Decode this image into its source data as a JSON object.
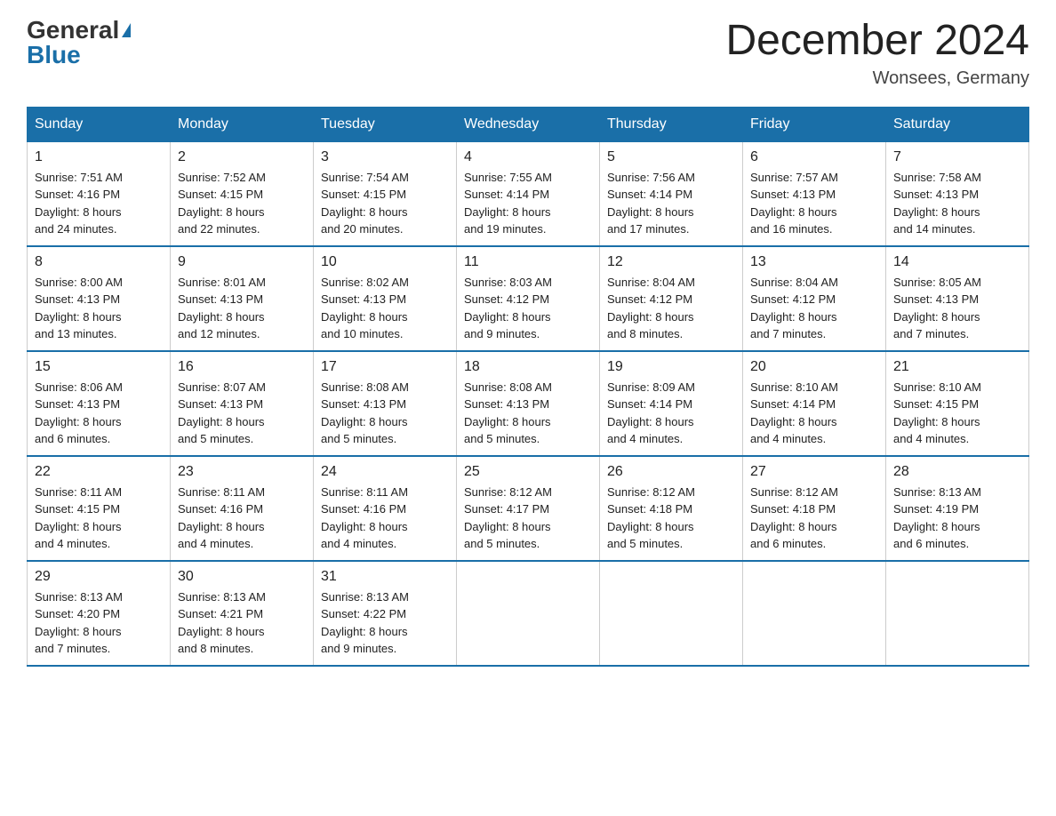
{
  "logo": {
    "general": "General",
    "blue": "Blue"
  },
  "header": {
    "month_year": "December 2024",
    "location": "Wonsees, Germany"
  },
  "days_of_week": [
    "Sunday",
    "Monday",
    "Tuesday",
    "Wednesday",
    "Thursday",
    "Friday",
    "Saturday"
  ],
  "weeks": [
    [
      {
        "day": "1",
        "info": "Sunrise: 7:51 AM\nSunset: 4:16 PM\nDaylight: 8 hours\nand 24 minutes."
      },
      {
        "day": "2",
        "info": "Sunrise: 7:52 AM\nSunset: 4:15 PM\nDaylight: 8 hours\nand 22 minutes."
      },
      {
        "day": "3",
        "info": "Sunrise: 7:54 AM\nSunset: 4:15 PM\nDaylight: 8 hours\nand 20 minutes."
      },
      {
        "day": "4",
        "info": "Sunrise: 7:55 AM\nSunset: 4:14 PM\nDaylight: 8 hours\nand 19 minutes."
      },
      {
        "day": "5",
        "info": "Sunrise: 7:56 AM\nSunset: 4:14 PM\nDaylight: 8 hours\nand 17 minutes."
      },
      {
        "day": "6",
        "info": "Sunrise: 7:57 AM\nSunset: 4:13 PM\nDaylight: 8 hours\nand 16 minutes."
      },
      {
        "day": "7",
        "info": "Sunrise: 7:58 AM\nSunset: 4:13 PM\nDaylight: 8 hours\nand 14 minutes."
      }
    ],
    [
      {
        "day": "8",
        "info": "Sunrise: 8:00 AM\nSunset: 4:13 PM\nDaylight: 8 hours\nand 13 minutes."
      },
      {
        "day": "9",
        "info": "Sunrise: 8:01 AM\nSunset: 4:13 PM\nDaylight: 8 hours\nand 12 minutes."
      },
      {
        "day": "10",
        "info": "Sunrise: 8:02 AM\nSunset: 4:13 PM\nDaylight: 8 hours\nand 10 minutes."
      },
      {
        "day": "11",
        "info": "Sunrise: 8:03 AM\nSunset: 4:12 PM\nDaylight: 8 hours\nand 9 minutes."
      },
      {
        "day": "12",
        "info": "Sunrise: 8:04 AM\nSunset: 4:12 PM\nDaylight: 8 hours\nand 8 minutes."
      },
      {
        "day": "13",
        "info": "Sunrise: 8:04 AM\nSunset: 4:12 PM\nDaylight: 8 hours\nand 7 minutes."
      },
      {
        "day": "14",
        "info": "Sunrise: 8:05 AM\nSunset: 4:13 PM\nDaylight: 8 hours\nand 7 minutes."
      }
    ],
    [
      {
        "day": "15",
        "info": "Sunrise: 8:06 AM\nSunset: 4:13 PM\nDaylight: 8 hours\nand 6 minutes."
      },
      {
        "day": "16",
        "info": "Sunrise: 8:07 AM\nSunset: 4:13 PM\nDaylight: 8 hours\nand 5 minutes."
      },
      {
        "day": "17",
        "info": "Sunrise: 8:08 AM\nSunset: 4:13 PM\nDaylight: 8 hours\nand 5 minutes."
      },
      {
        "day": "18",
        "info": "Sunrise: 8:08 AM\nSunset: 4:13 PM\nDaylight: 8 hours\nand 5 minutes."
      },
      {
        "day": "19",
        "info": "Sunrise: 8:09 AM\nSunset: 4:14 PM\nDaylight: 8 hours\nand 4 minutes."
      },
      {
        "day": "20",
        "info": "Sunrise: 8:10 AM\nSunset: 4:14 PM\nDaylight: 8 hours\nand 4 minutes."
      },
      {
        "day": "21",
        "info": "Sunrise: 8:10 AM\nSunset: 4:15 PM\nDaylight: 8 hours\nand 4 minutes."
      }
    ],
    [
      {
        "day": "22",
        "info": "Sunrise: 8:11 AM\nSunset: 4:15 PM\nDaylight: 8 hours\nand 4 minutes."
      },
      {
        "day": "23",
        "info": "Sunrise: 8:11 AM\nSunset: 4:16 PM\nDaylight: 8 hours\nand 4 minutes."
      },
      {
        "day": "24",
        "info": "Sunrise: 8:11 AM\nSunset: 4:16 PM\nDaylight: 8 hours\nand 4 minutes."
      },
      {
        "day": "25",
        "info": "Sunrise: 8:12 AM\nSunset: 4:17 PM\nDaylight: 8 hours\nand 5 minutes."
      },
      {
        "day": "26",
        "info": "Sunrise: 8:12 AM\nSunset: 4:18 PM\nDaylight: 8 hours\nand 5 minutes."
      },
      {
        "day": "27",
        "info": "Sunrise: 8:12 AM\nSunset: 4:18 PM\nDaylight: 8 hours\nand 6 minutes."
      },
      {
        "day": "28",
        "info": "Sunrise: 8:13 AM\nSunset: 4:19 PM\nDaylight: 8 hours\nand 6 minutes."
      }
    ],
    [
      {
        "day": "29",
        "info": "Sunrise: 8:13 AM\nSunset: 4:20 PM\nDaylight: 8 hours\nand 7 minutes."
      },
      {
        "day": "30",
        "info": "Sunrise: 8:13 AM\nSunset: 4:21 PM\nDaylight: 8 hours\nand 8 minutes."
      },
      {
        "day": "31",
        "info": "Sunrise: 8:13 AM\nSunset: 4:22 PM\nDaylight: 8 hours\nand 9 minutes."
      },
      {
        "day": "",
        "info": ""
      },
      {
        "day": "",
        "info": ""
      },
      {
        "day": "",
        "info": ""
      },
      {
        "day": "",
        "info": ""
      }
    ]
  ]
}
